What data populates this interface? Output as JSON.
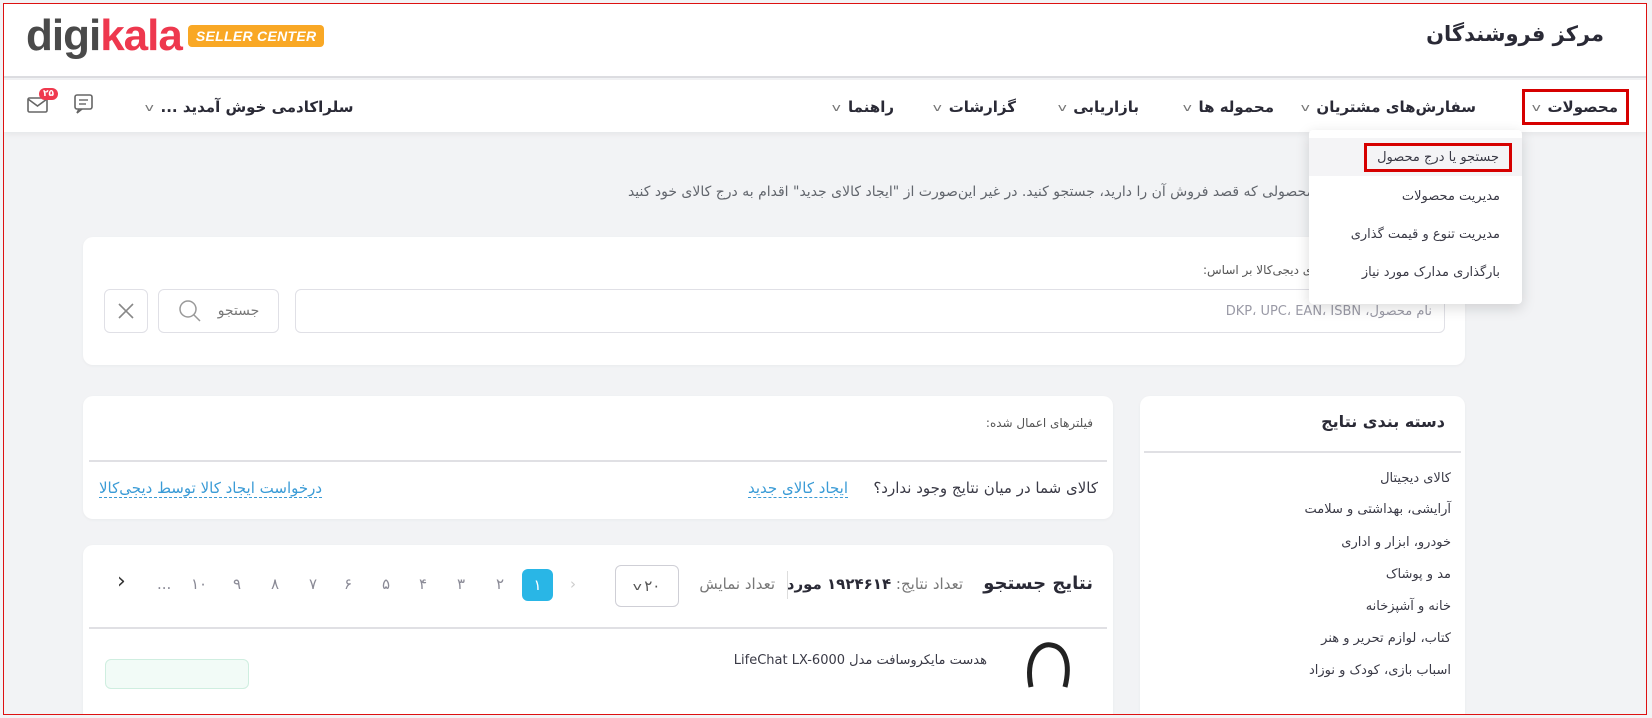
{
  "header": {
    "logo": {
      "part1": "digi",
      "part2": "kala",
      "badge": "SELLER CENTER"
    },
    "title": "مرکز فروشندگان"
  },
  "nav": {
    "items": [
      {
        "label": "محصولات"
      },
      {
        "label": "سفارش‌های مشتریان"
      },
      {
        "label": "محموله ها"
      },
      {
        "label": "بازاریابی"
      },
      {
        "label": "گزارشات"
      },
      {
        "label": "راهنما"
      }
    ],
    "user_label": "سلراکادمی خوش آمدید ...",
    "mail_badge": "۲۵"
  },
  "dropdown": {
    "items": [
      {
        "label": "جستجو یا درج محصول"
      },
      {
        "label": "مدیریت محصولات"
      },
      {
        "label": "مدیریت تنوع و قیمت گذاری"
      },
      {
        "label": "بارگذاری مدارک مورد نیاز"
      }
    ]
  },
  "intro": "محصولی که قصد فروش آن را دارید، جستجو کنید. در غیر این‌صورت از \"ایجاد کالای جدید\" اقدام به درج کالای خود کنید",
  "search": {
    "label": "لاهای دیجی‌کالا بر اساس:",
    "placeholder": "نام محصول، DKP، UPC، EAN، ISBN",
    "button_label": "جستجو"
  },
  "categories": {
    "title": "دسته بندی نتایج",
    "items": [
      "کالای دیجیتال",
      "آرایشی، بهداشتی و سلامت",
      "خودرو، ابزار و اداری",
      "مد و پوشاک",
      "خانه و آشپزخانه",
      "کتاب، لوازم تحریر و هنر",
      "اسباب بازی، کودک و نوزاد"
    ]
  },
  "filters": {
    "label": "فیلترهای اعمال شده:",
    "no_result_text": "کالای شما در میان نتایج وجود ندارد؟",
    "create_link": "ایجاد کالای جدید",
    "request_link": "درخواست ایجاد کالا توسط دیجی‌کالا"
  },
  "results": {
    "title": "نتایج جستجو",
    "count_label": "تعداد نتایج:",
    "count_value": "۱۹۲۴۶۱۴ مورد",
    "show_label": "تعداد نمایش",
    "page_size": "۲۰",
    "pages": [
      "۱",
      "۲",
      "۳",
      "۴",
      "۵",
      "۶",
      "۷",
      "۸",
      "۹",
      "۱۰",
      "..."
    ],
    "active_page": "۱",
    "product_name": "هدست مایکروسافت مدل LifeChat LX-6000"
  },
  "colors": {
    "brand_red": "#ef394e",
    "brand_badge": "#f9a825",
    "accent_blue": "#29b6e6",
    "highlight_red": "#d60000"
  }
}
